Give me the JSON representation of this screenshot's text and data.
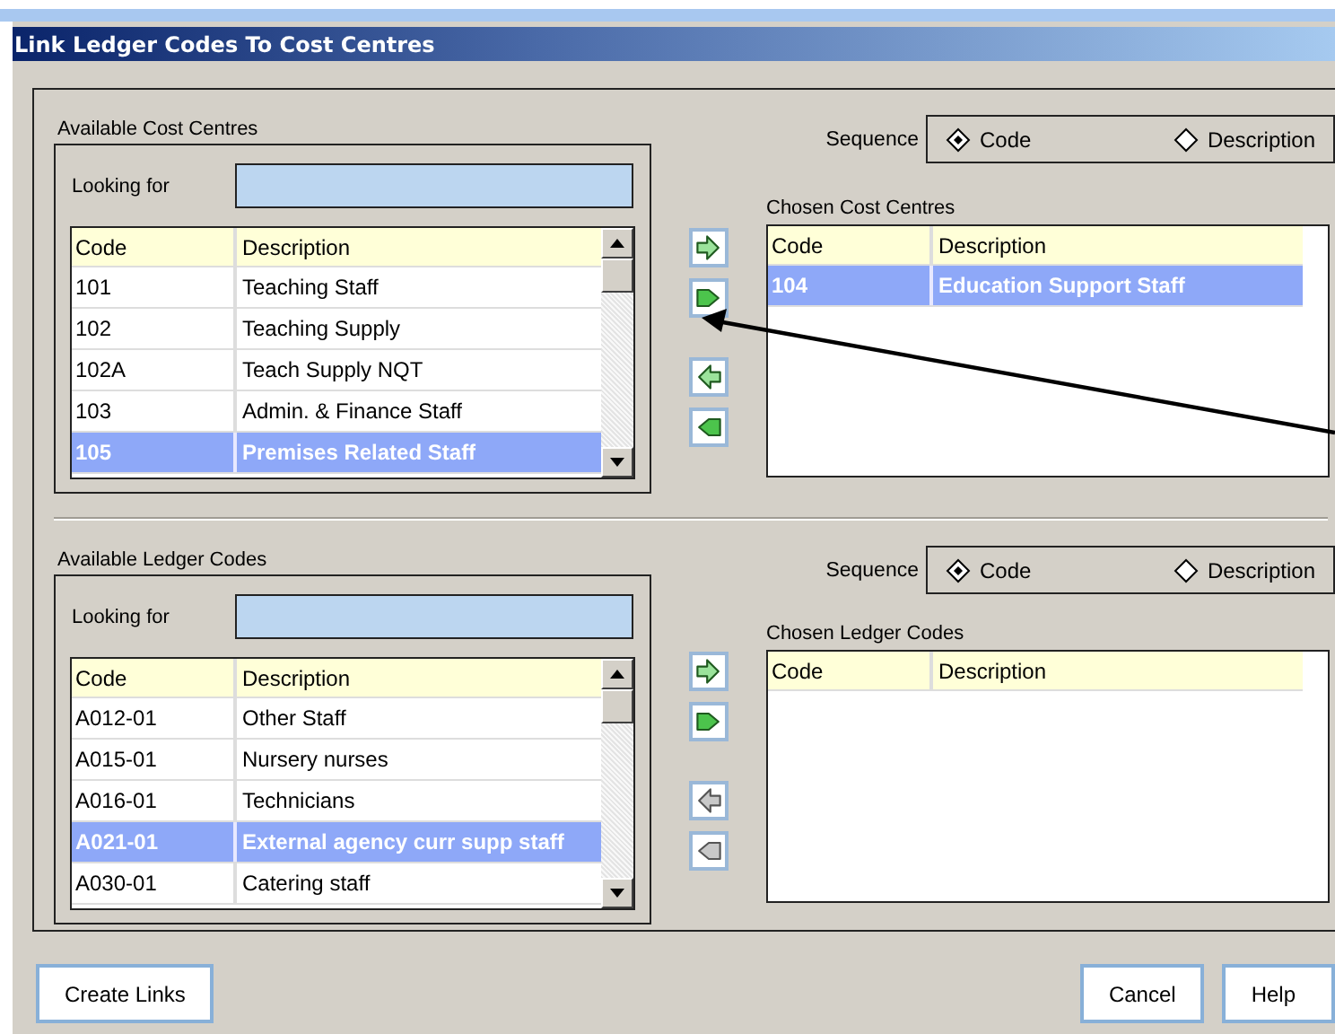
{
  "window": {
    "title": "Link Ledger Codes To Cost Centres"
  },
  "sections": [
    {
      "available": {
        "label": "Available Cost Centres",
        "search_label": "Looking for",
        "columns": [
          "Code",
          "Description"
        ],
        "rows": [
          {
            "code": "101",
            "description": "Teaching Staff",
            "selected": false
          },
          {
            "code": "102",
            "description": "Teaching Supply",
            "selected": false
          },
          {
            "code": "102A",
            "description": "Teach Supply NQT",
            "selected": false
          },
          {
            "code": "103",
            "description": "Admin. & Finance Staff",
            "selected": false
          },
          {
            "code": "105",
            "description": "Premises Related Staff",
            "selected": true
          }
        ]
      },
      "transfer_buttons": [
        {
          "kind": "add",
          "disabled": false
        },
        {
          "kind": "add-all",
          "disabled": false
        },
        {
          "kind": "remove",
          "disabled": false
        },
        {
          "kind": "remove-all",
          "disabled": false
        }
      ],
      "sequence": {
        "label": "Sequence",
        "options": [
          {
            "label": "Code",
            "selected": true
          },
          {
            "label": "Description",
            "selected": false
          }
        ]
      },
      "chosen": {
        "label": "Chosen Cost Centres",
        "columns": [
          "Code",
          "Description"
        ],
        "rows": [
          {
            "code": "104",
            "description": "Education Support Staff",
            "selected": true
          }
        ]
      }
    },
    {
      "available": {
        "label": "Available Ledger Codes",
        "search_label": "Looking for",
        "columns": [
          "Code",
          "Description"
        ],
        "rows": [
          {
            "code": "A012-01",
            "description": "Other Staff",
            "selected": false
          },
          {
            "code": "A015-01",
            "description": "Nursery nurses",
            "selected": false
          },
          {
            "code": "A016-01",
            "description": "Technicians",
            "selected": false
          },
          {
            "code": "A021-01",
            "description": "External agency curr supp staff",
            "selected": true
          },
          {
            "code": "A030-01",
            "description": "Catering staff",
            "selected": false
          }
        ]
      },
      "transfer_buttons": [
        {
          "kind": "add",
          "disabled": false
        },
        {
          "kind": "add-all",
          "disabled": false
        },
        {
          "kind": "remove",
          "disabled": true
        },
        {
          "kind": "remove-all",
          "disabled": true
        }
      ],
      "sequence": {
        "label": "Sequence",
        "options": [
          {
            "label": "Code",
            "selected": true
          },
          {
            "label": "Description",
            "selected": false
          }
        ]
      },
      "chosen": {
        "label": "Chosen Ledger Codes",
        "columns": [
          "Code",
          "Description"
        ]
      }
    }
  ],
  "footer": {
    "left_buttons": [
      {
        "label": "Create Links"
      }
    ],
    "right_buttons": [
      {
        "label": "Cancel"
      },
      {
        "label": "Help"
      }
    ]
  }
}
